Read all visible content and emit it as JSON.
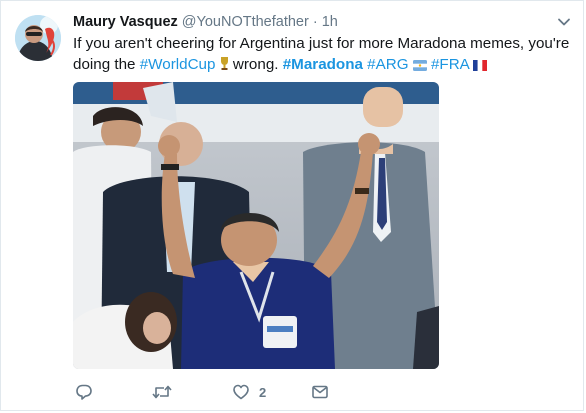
{
  "tweet": {
    "author_name": "Maury Vasquez",
    "author_handle": "@YouNOTthefather",
    "separator": "·",
    "timestamp": "1h",
    "text_part1": "If you aren't cheering for Argentina just for more Maradona memes, you're doing the",
    "hashtag_worldcup": "#WorldCup",
    "text_part2": "wrong.",
    "hashtag_maradona": "#Maradona",
    "hashtag_arg": "#ARG",
    "hashtag_fra": "#FRA",
    "like_count": "2"
  },
  "icons": {
    "reply": "reply-icon",
    "retweet": "retweet-icon",
    "like": "heart-icon",
    "dm": "envelope-icon",
    "menu": "chevron-down-icon"
  },
  "colors": {
    "link": "#1b95e0",
    "muted": "#657786",
    "text": "#14171a"
  }
}
